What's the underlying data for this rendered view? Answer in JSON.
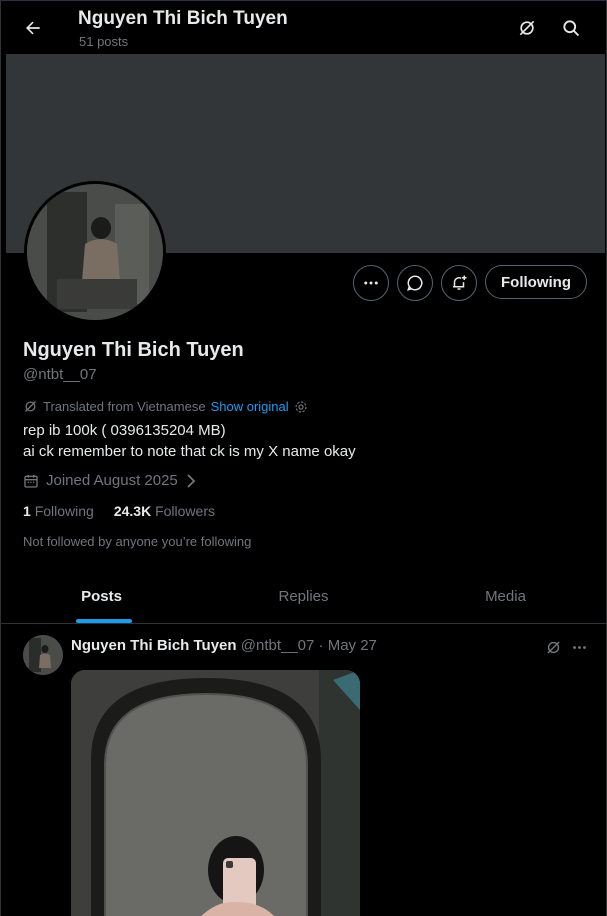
{
  "header": {
    "name": "Nguyen Thi Bich Tuyen",
    "post_count": "51 posts"
  },
  "profile": {
    "display_name": "Nguyen Thi Bich Tuyen",
    "handle": "@ntbt__07",
    "translated_label": "Translated from Vietnamese",
    "show_original": "Show original",
    "bio_line1": "rep ib 100k ( 0396135204 MB)",
    "bio_line2": "ai ck remember to note that ck is my X name okay",
    "joined": "Joined August 2025",
    "following_count": "1",
    "following_label": "Following",
    "followers_count": "24.3K",
    "followers_label": "Followers",
    "not_followed": "Not followed by anyone you’re following",
    "follow_button": "Following"
  },
  "tabs": [
    {
      "label": "Posts",
      "active": true
    },
    {
      "label": "Replies",
      "active": false
    },
    {
      "label": "Media",
      "active": false
    }
  ],
  "post": {
    "author": "Nguyen Thi Bich Tuyen",
    "meta": "@ntbt__07 · May 27"
  },
  "colors": {
    "accent": "#1d9bf0",
    "background": "#000000",
    "banner": "#333639",
    "muted_text": "#71767b"
  },
  "icons": [
    "back-arrow-icon",
    "grok-icon",
    "search-icon",
    "more-icon",
    "message-icon",
    "notification-add-icon",
    "calendar-icon",
    "chevron-right-icon",
    "settings-icon"
  ]
}
